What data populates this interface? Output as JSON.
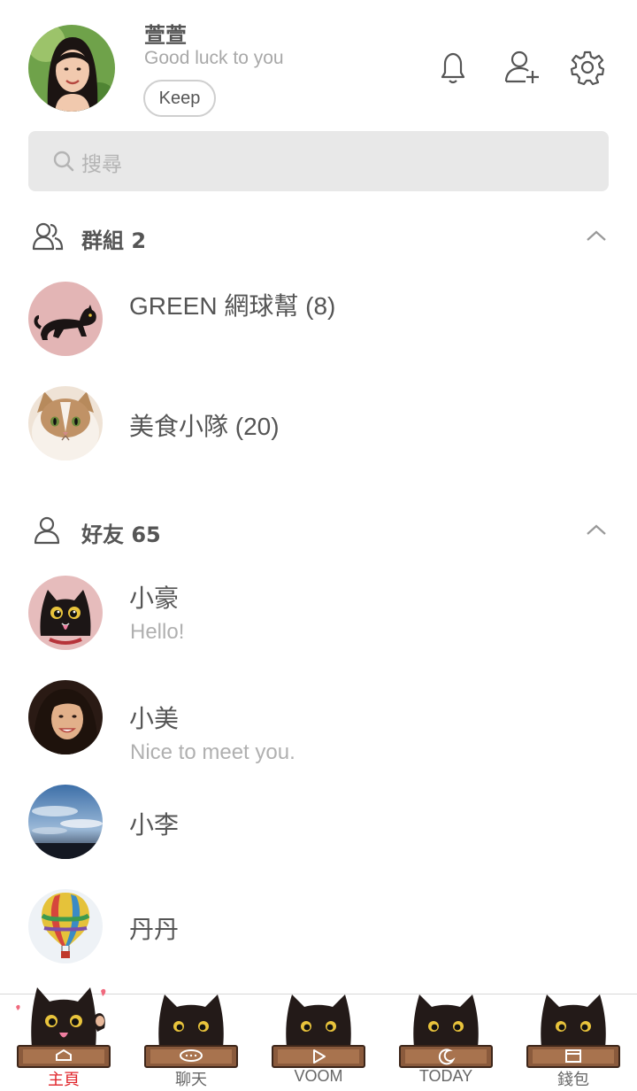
{
  "profile": {
    "name": "萱萱",
    "status": "Good luck to you",
    "keep_label": "Keep"
  },
  "header_icons": [
    "bell-icon",
    "add-friend-icon",
    "settings-gear-icon"
  ],
  "search": {
    "placeholder": "搜尋"
  },
  "groups": {
    "title": "群組 2",
    "expanded": true,
    "items": [
      {
        "name": "GREEN 網球幫 (8)",
        "avatar": "black-cat-pink-bg"
      },
      {
        "name": "美食小隊 (20)",
        "avatar": "fluffy-cat"
      }
    ]
  },
  "friends": {
    "title": "好友 65",
    "expanded": true,
    "items": [
      {
        "name": "小豪",
        "message": "Hello!",
        "avatar": "black-cat-face"
      },
      {
        "name": "小美",
        "message": "Nice to meet you.",
        "avatar": "woman-portrait"
      },
      {
        "name": "小李",
        "message": "",
        "avatar": "cloudy-sky"
      },
      {
        "name": "丹丹",
        "message": "",
        "avatar": "hot-air-balloon"
      }
    ]
  },
  "bottom_nav": {
    "active_index": 0,
    "items": [
      {
        "label": "主頁",
        "icon": "home-icon"
      },
      {
        "label": "聊天",
        "icon": "chat-bubble-icon"
      },
      {
        "label": "VOOM",
        "icon": "voom-play-icon"
      },
      {
        "label": "TODAY",
        "icon": "today-moon-icon"
      },
      {
        "label": "錢包",
        "icon": "wallet-icon"
      }
    ]
  },
  "colors": {
    "active_tab": "#e0242a",
    "search_bg": "#e8e8e8",
    "secondary_text": "#b0b0b0",
    "cat_board": "#8a5a3c"
  }
}
